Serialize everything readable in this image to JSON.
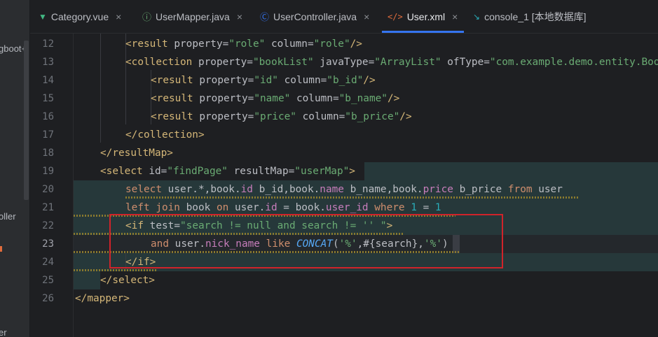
{
  "sidebar_fragments": [
    "gboot+",
    "oller",
    "er"
  ],
  "tabs": [
    {
      "label": "Category.vue",
      "icon": "vue-icon",
      "icon_color": "#42b883",
      "active": false
    },
    {
      "label": "UserMapper.java",
      "icon": "interface-icon",
      "icon_color": "#6aab73",
      "active": false
    },
    {
      "label": "UserController.java",
      "icon": "class-icon",
      "icon_color": "#3574f0",
      "active": false
    },
    {
      "label": "User.xml",
      "icon": "xml-icon",
      "icon_color": "#e06c3c",
      "active": true
    },
    {
      "label": "console_1 [本地数据库]",
      "icon": "console-icon",
      "icon_color": "#2aacb8",
      "active": false
    }
  ],
  "line_numbers": [
    "12",
    "13",
    "14",
    "15",
    "16",
    "17",
    "18",
    "19",
    "20",
    "21",
    "22",
    "23",
    "24",
    "25",
    "26"
  ],
  "current_line": "23",
  "code": {
    "l12": {
      "open": "<result",
      "a1": "property",
      "v1": "\"role\"",
      "a2": "column",
      "v2": "\"role\"",
      "close": "/>"
    },
    "l13": {
      "open": "<collection",
      "a1": "property",
      "v1": "\"bookList\"",
      "a2": "javaType",
      "v2": "\"ArrayList\"",
      "a3": "ofType",
      "v3": "\"com.example.demo.entity.Book\">"
    },
    "l14": {
      "open": "<result",
      "a1": "property",
      "v1": "\"id\"",
      "a2": "column",
      "v2": "\"b_id\"",
      "close": "/>"
    },
    "l15": {
      "open": "<result",
      "a1": "property",
      "v1": "\"name\"",
      "a2": "column",
      "v2": "\"b_name\"",
      "close": "/>"
    },
    "l16": {
      "open": "<result",
      "a1": "property",
      "v1": "\"price\"",
      "a2": "column",
      "v2": "\"b_price\"",
      "close": "/>"
    },
    "l17": {
      "tag": "</collection>"
    },
    "l18": {
      "tag": "</resultMap>"
    },
    "l19": {
      "open": "<select",
      "a1": "id",
      "v1": "\"findPage\"",
      "a2": "resultMap",
      "v2": "\"userMap\"",
      "close": ">"
    },
    "l20": {
      "k1": "select",
      "t1": "user.",
      "star": "*",
      "c1": ",book.",
      "f1": "id",
      "t2": " b_id,book.",
      "f2": "name",
      "t3": " b_name,book.",
      "f3": "price",
      "t4": " b_price ",
      "k2": "from",
      "t5": " user"
    },
    "l21": {
      "k1": "left join",
      "t1": " book ",
      "k2": "on",
      "t2": " user.",
      "f1": "id",
      "t3": " = book.",
      "f2": "user_id",
      "t4": " ",
      "k3": "where",
      "t5": " ",
      "n1": "1",
      "t6": " = ",
      "n2": "1"
    },
    "l22": {
      "open": "<if",
      "a1": "test",
      "v1": "\"search != null and search != '' \"",
      "close": ">"
    },
    "l23": {
      "k1": "and",
      "t1": " user.",
      "f1": "nick_name",
      "t2": " ",
      "k2": "like",
      "t3": " ",
      "fn": "CONCAT",
      "p1": "(",
      "s1": "'%'",
      "t4": ",#{search},",
      "s2": "'%'",
      "p2": ")"
    },
    "l24": {
      "tag": "</if>"
    },
    "l25": {
      "tag": "</select>"
    },
    "l26": {
      "tag": "</mapper>"
    }
  }
}
